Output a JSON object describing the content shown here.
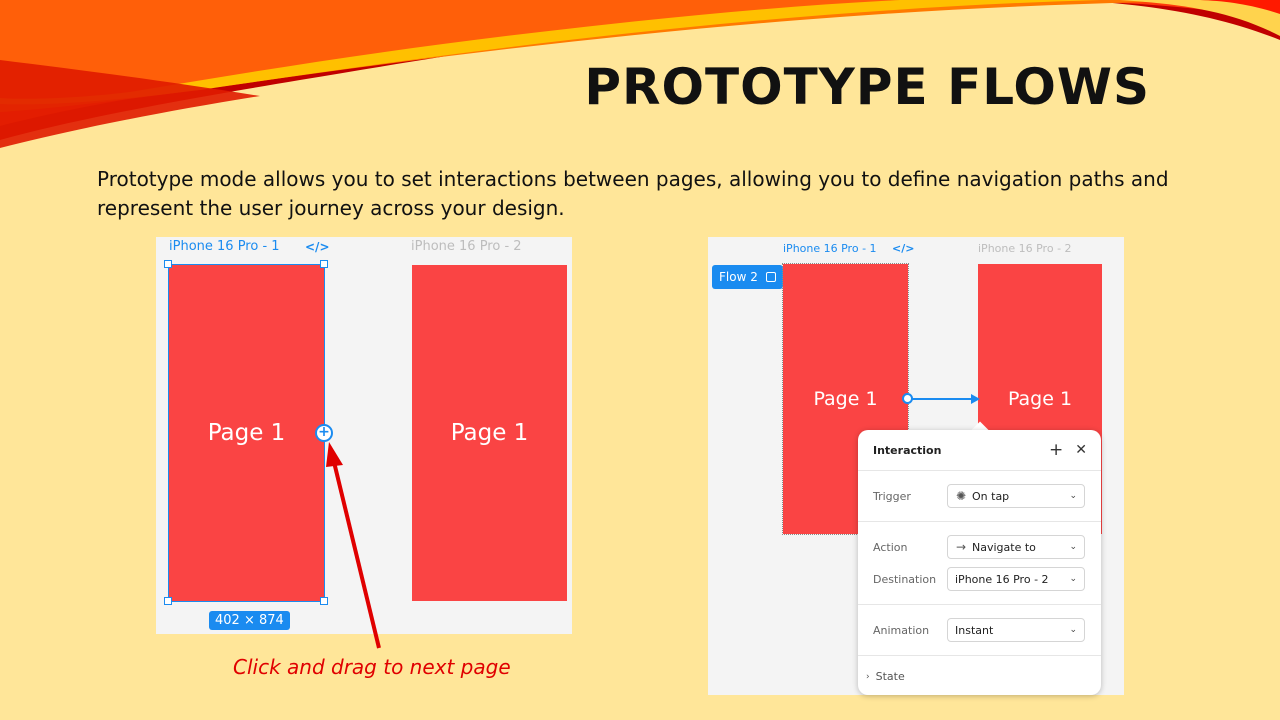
{
  "slide": {
    "title": "PROTOTYPE FLOWS",
    "description": "Prototype mode allows you to set interactions between pages, allowing  you to define navigation paths and represent the user journey across your design.",
    "caption": "Click and drag to next page"
  },
  "left_canvas": {
    "frame1_label": "iPhone 16 Pro - 1",
    "frame2_label": "iPhone 16 Pro - 2",
    "code_icon": "</>",
    "page1_text": "Page 1",
    "page2_text": "Page 1",
    "size_badge": "402 × 874",
    "add_connection_icon": "plus-circle-icon"
  },
  "right_canvas": {
    "frame1_label": "iPhone 16 Pro - 1",
    "frame2_label": "iPhone 16 Pro - 2",
    "code_icon": "</>",
    "flow_tag": "Flow 2",
    "page1_text": "Page 1",
    "page2_text": "Page 1"
  },
  "interaction_panel": {
    "title": "Interaction",
    "add_icon": "+",
    "close_icon": "✕",
    "trigger_label": "Trigger",
    "trigger_value": "On tap",
    "action_label": "Action",
    "action_value": "Navigate to",
    "destination_label": "Destination",
    "destination_value": "iPhone 16 Pro - 2",
    "animation_label": "Animation",
    "animation_value": "Instant",
    "state_label": "State",
    "chevron": "⌄"
  },
  "colors": {
    "background": "#ffe699",
    "page_red": "#fa4444",
    "accent_blue": "#1a8bf0",
    "caption_red": "#e00000"
  }
}
